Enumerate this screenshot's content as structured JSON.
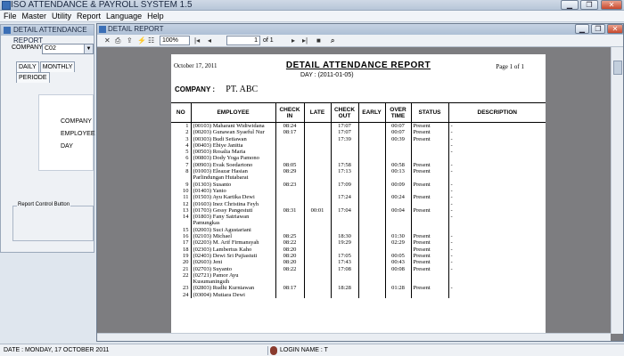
{
  "app": {
    "title": "ISO ATTENDANCE & PAYROLL SYSTEM 1.5",
    "window_controls": {
      "minimize": "▁",
      "restore": "❐",
      "close": "✕"
    }
  },
  "menu": [
    "File",
    "Master",
    "Utility",
    "Report",
    "Language",
    "Help"
  ],
  "left_window": {
    "title": "DETAIL ATTENDANCE REPORT",
    "company_label": "COMPANY",
    "company_value": "C02",
    "tabs": [
      "DAILY",
      "MONTHLY",
      "PERIODE"
    ],
    "panel_labels": [
      "COMPANY",
      "EMPLOYEE",
      "DAY"
    ],
    "report_control_label": "Report Control Button"
  },
  "detail_window": {
    "title": "DETAIL REPORT",
    "zoom": "100%",
    "page_current": "1",
    "page_of": "of 1"
  },
  "report": {
    "date": "October 17, 2011",
    "title": "DETAIL ATTENDANCE REPORT",
    "day_line": "DAY : (2011-01-05)",
    "page": "Page 1 of 1",
    "company_label": "COMPANY :",
    "company_value": "PT. ABC",
    "columns": [
      "NO",
      "EMPLOYEE",
      "CHECK IN",
      "LATE",
      "CHECK OUT",
      "EARLY",
      "OVER TIME",
      "STATUS",
      "DESCRIPTION"
    ],
    "rows": [
      [
        "1",
        "(00103) Maharani Widiwidana",
        "08:24",
        "",
        "17:07",
        "",
        "00:07",
        "Present",
        "-"
      ],
      [
        "2",
        "(00203) Gunawan Syaeful Nur",
        "08:17",
        "",
        "17:07",
        "",
        "00:07",
        "Present",
        "-"
      ],
      [
        "3",
        "(00303) Budi Setiawan",
        "",
        "",
        "17:39",
        "",
        "00:39",
        "Present",
        "-"
      ],
      [
        "4",
        "(00403) Ebiye Janitta",
        "",
        "",
        "",
        "",
        "",
        "",
        "-"
      ],
      [
        "5",
        "(00503) Rosalia Maria",
        "",
        "",
        "",
        "",
        "",
        "",
        "-"
      ],
      [
        "6",
        "(00803) Dody Yoga Pamono",
        "",
        "",
        "",
        "",
        "",
        "",
        ""
      ],
      [
        "7",
        "(00903) Evak Soedartono",
        "08:05",
        "",
        "17:58",
        "",
        "00:58",
        "Present",
        "-"
      ],
      [
        "8",
        "(01003) Eleazar Hasian",
        "08:29",
        "",
        "17:13",
        "",
        "00:13",
        "Present",
        "-"
      ],
      [
        "",
        "Parlindungan Hutabarat",
        "",
        "",
        "",
        "",
        "",
        "",
        ""
      ],
      [
        "9",
        "(01303) Susanto",
        "08:23",
        "",
        "17:09",
        "",
        "00:09",
        "Present",
        "-"
      ],
      [
        "10",
        "(01403) Yanto",
        "",
        "",
        "",
        "",
        "",
        "",
        "-"
      ],
      [
        "11",
        "(01503) Ayu Kartika Dewi",
        "",
        "",
        "17:24",
        "",
        "00:24",
        "Present",
        "-"
      ],
      [
        "12",
        "(01603) Inez Christina Feyh",
        "",
        "",
        "",
        "",
        "",
        "",
        "-"
      ],
      [
        "13",
        "(01703) Gessy Pangestuti",
        "08:31",
        "00:01",
        "17:04",
        "",
        "00:04",
        "Present",
        "-"
      ],
      [
        "14",
        "(01803) Fany Satriawan",
        "",
        "",
        "",
        "",
        "",
        "",
        "-"
      ],
      [
        "",
        "Pamungkas",
        "",
        "",
        "",
        "",
        "",
        "",
        ""
      ],
      [
        "15",
        "(02003) Suci Agustariani",
        "",
        "",
        "",
        "",
        "",
        "",
        ""
      ],
      [
        "16",
        "(02103) Michael",
        "08:25",
        "",
        "18:30",
        "",
        "01:30",
        "Present",
        "-"
      ],
      [
        "17",
        "(02203) M. Arif Firmansyah",
        "08:22",
        "",
        "19:29",
        "",
        "02:29",
        "Present",
        "-"
      ],
      [
        "18",
        "(02303) Lambertus Kaho",
        "08:20",
        "",
        "",
        "",
        "",
        "Present",
        "-"
      ],
      [
        "19",
        "(02403) Dewi Sri Pujiastuti",
        "08:20",
        "",
        "17:05",
        "",
        "00:05",
        "Present",
        "-"
      ],
      [
        "20",
        "(02603) Jeni",
        "08:20",
        "",
        "17:43",
        "",
        "00:43",
        "Present",
        "-"
      ],
      [
        "21",
        "(02703) Suyanto",
        "08:22",
        "",
        "17:08",
        "",
        "00:08",
        "Present",
        "-"
      ],
      [
        "22",
        "(02721) Pamor Ayu",
        "",
        "",
        "",
        "",
        "",
        "",
        ""
      ],
      [
        "",
        "Kusumaningsih",
        "",
        "",
        "",
        "",
        "",
        "",
        ""
      ],
      [
        "23",
        "(02803) Rudhi Kurniawan",
        "08:17",
        "",
        "18:28",
        "",
        "01:28",
        "Present",
        "-"
      ],
      [
        "24",
        "(03004) Mutiara Dewi",
        "",
        "",
        "",
        "",
        "",
        "",
        ""
      ]
    ]
  },
  "statusbar": {
    "date": "DATE : MONDAY, 17 OCTOBER 2011",
    "login": "LOGIN NAME : T"
  }
}
